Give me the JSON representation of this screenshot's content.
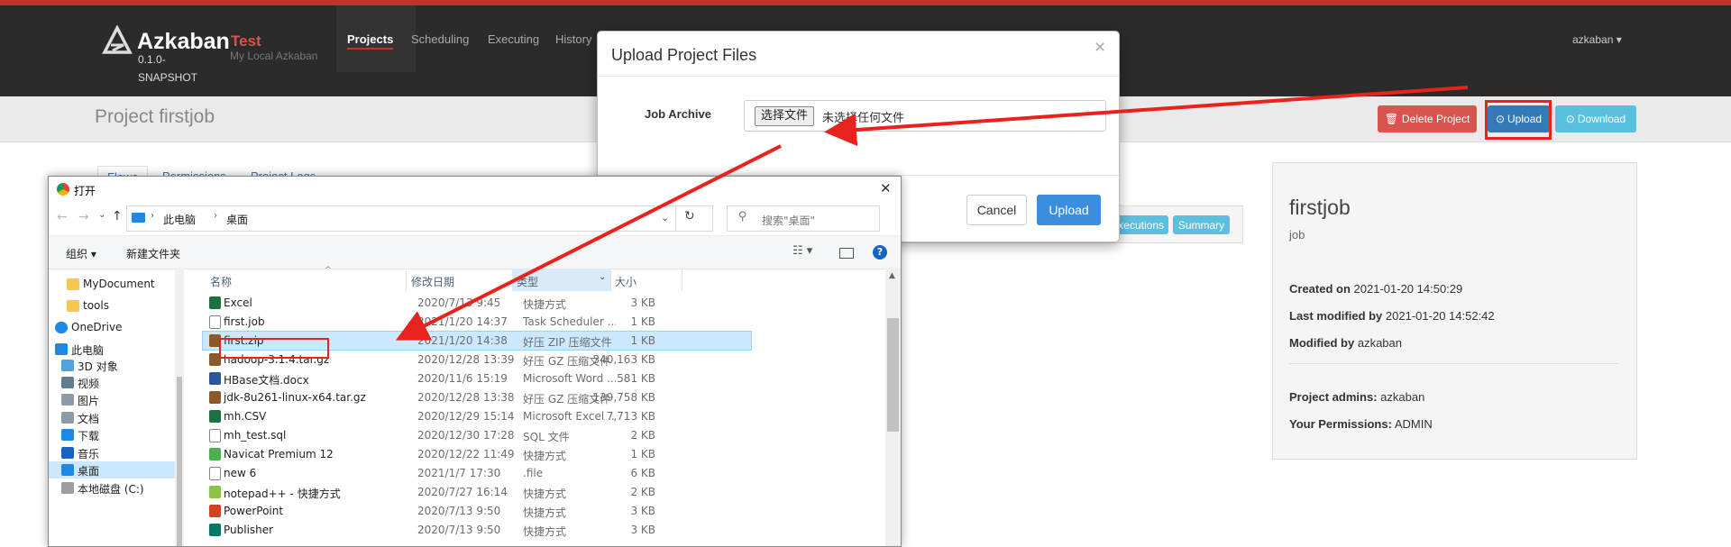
{
  "navbar": {
    "logo_name": "Azkaban",
    "version_line1": "0.1.0-",
    "version_line2": "SNAPSHOT",
    "env_name": "Test",
    "env_sub": "My Local Azkaban",
    "links": [
      "Projects",
      "Scheduling",
      "Executing",
      "History"
    ],
    "user": "azkaban ▾"
  },
  "page": {
    "title": "Project firstjob",
    "delete_label": "Delete Project",
    "upload_label": "Upload",
    "download_label": "Download",
    "tabs": [
      "Flows",
      "Permissions",
      "Project Logs"
    ],
    "executions_label": "Executions",
    "summary_label": "Summary"
  },
  "card": {
    "name": "firstjob",
    "desc": "job",
    "created_label": "Created on",
    "created_value": "2021-01-20 14:50:29",
    "modified_label": "Last modified by",
    "modified_value": "2021-01-20 14:52:42",
    "modified_by_label": "Modified by",
    "modified_by_value": "azkaban",
    "admins_label": "Project admins:",
    "admins_value": "azkaban",
    "perm_label": "Your Permissions:",
    "perm_value": "ADMIN"
  },
  "modal": {
    "title": "Upload Project Files",
    "close": "×",
    "job_archive_label": "Job Archive",
    "choose_file_label": "选择文件",
    "no_file_label": "未选择任何文件",
    "cancel_label": "Cancel",
    "upload_label": "Upload"
  },
  "dialog": {
    "title": "打开",
    "close": "✕",
    "breadcrumb": [
      "此电脑",
      "桌面"
    ],
    "search_placeholder": "搜索\"桌面\"",
    "organize_label": "组织 ▾",
    "new_folder_label": "新建文件夹",
    "columns": {
      "name": "名称",
      "date": "修改日期",
      "type": "类型",
      "size": "大小"
    },
    "nav": [
      {
        "label": "MyDocument",
        "icon": "folder-icon"
      },
      {
        "label": "tools",
        "icon": "folder-icon"
      },
      {
        "label": "OneDrive",
        "icon": "onedrive-cloud-icon"
      },
      {
        "label": "此电脑",
        "icon": "pc-icon"
      },
      {
        "label": "3D 对象",
        "icon": "3d-objects-icon"
      },
      {
        "label": "视频",
        "icon": "video-folder-icon"
      },
      {
        "label": "图片",
        "icon": "pictures-folder-icon"
      },
      {
        "label": "文档",
        "icon": "documents-folder-icon"
      },
      {
        "label": "下载",
        "icon": "download-folder-icon"
      },
      {
        "label": "音乐",
        "icon": "music-folder-icon"
      },
      {
        "label": "桌面",
        "icon": "desktop-folder-icon"
      },
      {
        "label": "本地磁盘 (C:)",
        "icon": "drive-icon"
      }
    ],
    "files": [
      {
        "name": "Excel",
        "date": "2020/7/13 9:45",
        "type": "快捷方式",
        "size": "3 KB",
        "icon": "excel-icon"
      },
      {
        "name": "first.job",
        "date": "2021/1/20 14:37",
        "type": "Task Scheduler ...",
        "size": "1 KB",
        "icon": "file-icon"
      },
      {
        "name": "first.zip",
        "date": "2021/1/20 14:38",
        "type": "好压 ZIP 压缩文件",
        "size": "1 KB",
        "icon": "zip-icon"
      },
      {
        "name": "hadoop-3.1.4.tar.gz",
        "date": "2020/12/28 13:39",
        "type": "好压 GZ 压缩文件",
        "size": "340,163 KB",
        "icon": "archive-icon"
      },
      {
        "name": "HBase文档.docx",
        "date": "2020/11/6 15:19",
        "type": "Microsoft Word ...",
        "size": "581 KB",
        "icon": "word-icon"
      },
      {
        "name": "jdk-8u261-linux-x64.tar.gz",
        "date": "2020/12/28 13:38",
        "type": "好压 GZ 压缩文件",
        "size": "139,758 KB",
        "icon": "archive-icon"
      },
      {
        "name": "mh.CSV",
        "date": "2020/12/29 15:14",
        "type": "Microsoft Excel ...",
        "size": "7,713 KB",
        "icon": "excel-icon"
      },
      {
        "name": "mh_test.sql",
        "date": "2020/12/30 17:28",
        "type": "SQL 文件",
        "size": "2 KB",
        "icon": "file-icon"
      },
      {
        "name": "Navicat Premium 12",
        "date": "2020/12/22 11:49",
        "type": "快捷方式",
        "size": "1 KB",
        "icon": "navicat-icon"
      },
      {
        "name": "new 6",
        "date": "2021/1/7 17:30",
        "type": ".file",
        "size": "6 KB",
        "icon": "file-icon"
      },
      {
        "name": "notepad++ - 快捷方式",
        "date": "2020/7/27 16:14",
        "type": "快捷方式",
        "size": "2 KB",
        "icon": "notepad-icon"
      },
      {
        "name": "PowerPoint",
        "date": "2020/7/13 9:50",
        "type": "快捷方式",
        "size": "3 KB",
        "icon": "powerpoint-icon"
      },
      {
        "name": "Publisher",
        "date": "2020/7/13 9:50",
        "type": "快捷方式",
        "size": "3 KB",
        "icon": "publisher-icon"
      }
    ]
  },
  "colors": {
    "accent_red": "#c9302c",
    "upload_blue": "#337ab7",
    "info": "#5bc0de",
    "annotation_red": "#e8231d",
    "selection": "#cce8ff"
  }
}
